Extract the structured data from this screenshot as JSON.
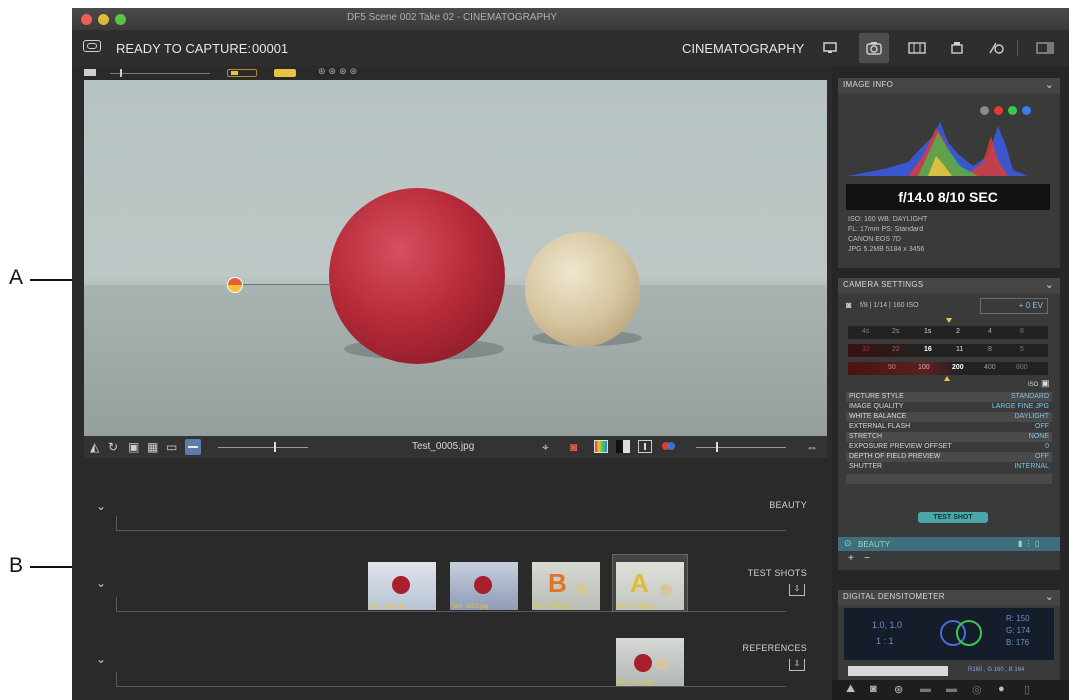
{
  "window": {
    "title": "DF5  Scene 002  Take 02 - CINEMATOGRAPHY"
  },
  "toolbar": {
    "status_label": "READY TO CAPTURE:",
    "capture_number": "00001",
    "mode_label": "CINEMATOGRAPHY"
  },
  "callouts": {
    "a": "A",
    "b": "B"
  },
  "viewer": {
    "filename": "Test_0005.jpg"
  },
  "collections": [
    {
      "label": "BEAUTY"
    },
    {
      "label": "TEST SHOTS"
    },
    {
      "label": "REFERENCES"
    }
  ],
  "thumbnails": [
    {
      "label": "Test_0001.jpg"
    },
    {
      "label": "Test_0002.jpg"
    },
    {
      "label": "Test_0003.jpg"
    },
    {
      "label": "Test_0005.jpg"
    },
    {
      "label": "Test_0004.jpg"
    }
  ],
  "image_info": {
    "title": "IMAGE INFO",
    "exposure": "f/14.0  8/10 SEC",
    "meta": [
      "ISO: 160   WB: DAYLIGHT",
      "FL: 17mm   PS: Standard",
      "CANON EOS 7D",
      "JPG  5.2MB  5184 x 3456"
    ],
    "dot_colors": [
      "#8a8a8a",
      "#e33b2f",
      "#39c94a",
      "#3b7de8"
    ]
  },
  "camera_settings": {
    "title": "CAMERA SETTINGS",
    "summary": "f/8 | 1/14 | 160 ISO",
    "ev": "+ 0 EV",
    "aperture_scale": [
      "4s",
      "2s",
      "1s",
      "2",
      "4",
      "8"
    ],
    "shutter_scale": [
      "32",
      "22",
      "16",
      "11",
      "8",
      "5"
    ],
    "iso_scale": [
      "50",
      "100",
      "200",
      "400",
      "800"
    ],
    "iso_label": "ISO",
    "rows": [
      {
        "k": "PICTURE STYLE",
        "v": "STANDARD"
      },
      {
        "k": "IMAGE QUALITY",
        "v": "LARGE FINE JPG"
      },
      {
        "k": "WHITE BALANCE",
        "v": "DAYLIGHT"
      },
      {
        "k": "EXTERNAL FLASH",
        "v": "OFF"
      },
      {
        "k": "STRETCH",
        "v": "NONE"
      },
      {
        "k": "EXPOSURE PREVIEW OFFSET",
        "v": "0"
      },
      {
        "k": "DEPTH OF FIELD PREVIEW",
        "v": "OFF"
      },
      {
        "k": "SHUTTER",
        "v": "INTERNAL"
      }
    ],
    "test_shot": "TEST SHOT",
    "collection_name": "BEAUTY",
    "add_symbol": "+",
    "remove_symbol": "−"
  },
  "densitometer": {
    "title": "DIGITAL DENSITOMETER",
    "ratio_top": "1.0, 1.0",
    "ratio_bottom": "1 : 1",
    "r": "R:  150",
    "g": "G:  174",
    "b": "B:  176",
    "readout": "R160 , G 160 , B 164"
  },
  "colors": {
    "accent": "#4aa6a8",
    "value_blue": "#7fc4e8",
    "thumb_label": "#e6c441"
  }
}
